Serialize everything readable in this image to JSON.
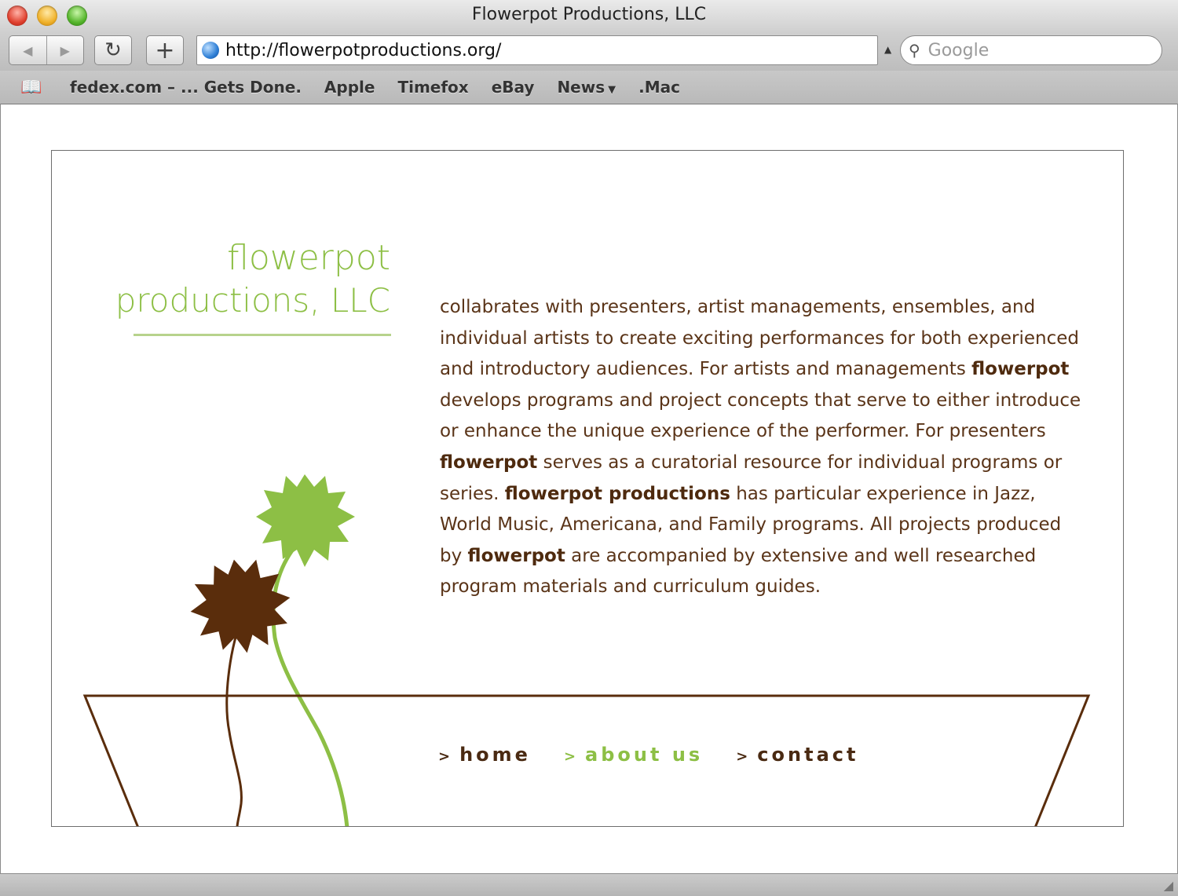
{
  "window": {
    "title": "Flowerpot Productions, LLC"
  },
  "toolbar": {
    "back_icon": "◀",
    "forward_icon": "▶",
    "reload_icon": "↻",
    "add_bookmark_icon": "+",
    "url": "http://flowerpotproductions.org/",
    "search_placeholder": "Google"
  },
  "bookmarks": {
    "items": [
      {
        "label": "fedex.com – ... Gets Done."
      },
      {
        "label": "Apple"
      },
      {
        "label": "Timefox"
      },
      {
        "label": "eBay"
      },
      {
        "label": "News"
      },
      {
        "label": ".Mac"
      }
    ]
  },
  "page": {
    "logo": {
      "line1": "flowerpot",
      "line2": "productions, LLC"
    },
    "description": [
      {
        "t": "collabrates with presenters, artist managements, ensembles, and individual artists to create exciting performances for both experienced and introductory audiences. For artists and managements ",
        "b": false
      },
      {
        "t": "flowerpot",
        "b": true
      },
      {
        "t": " develops programs and project concepts that serve to either introduce or enhance the unique experience of the performer. For presenters ",
        "b": false
      },
      {
        "t": "flowerpot",
        "b": true
      },
      {
        "t": " serves as a curatorial resource for individual programs or series. ",
        "b": false
      },
      {
        "t": "flowerpot productions",
        "b": true
      },
      {
        "t": " has particular experience in Jazz, World Music, Americana, and Family programs. All projects produced by ",
        "b": false
      },
      {
        "t": "flowerpot",
        "b": true
      },
      {
        "t": " are accompanied by extensive and well researched program materials and curriculum guides.",
        "b": false
      }
    ],
    "nav": {
      "chevron": ">",
      "home": "home",
      "about": "about us",
      "contact": "contact"
    }
  },
  "colors": {
    "green": "#8dbf45",
    "brown": "#4e2a0e"
  }
}
